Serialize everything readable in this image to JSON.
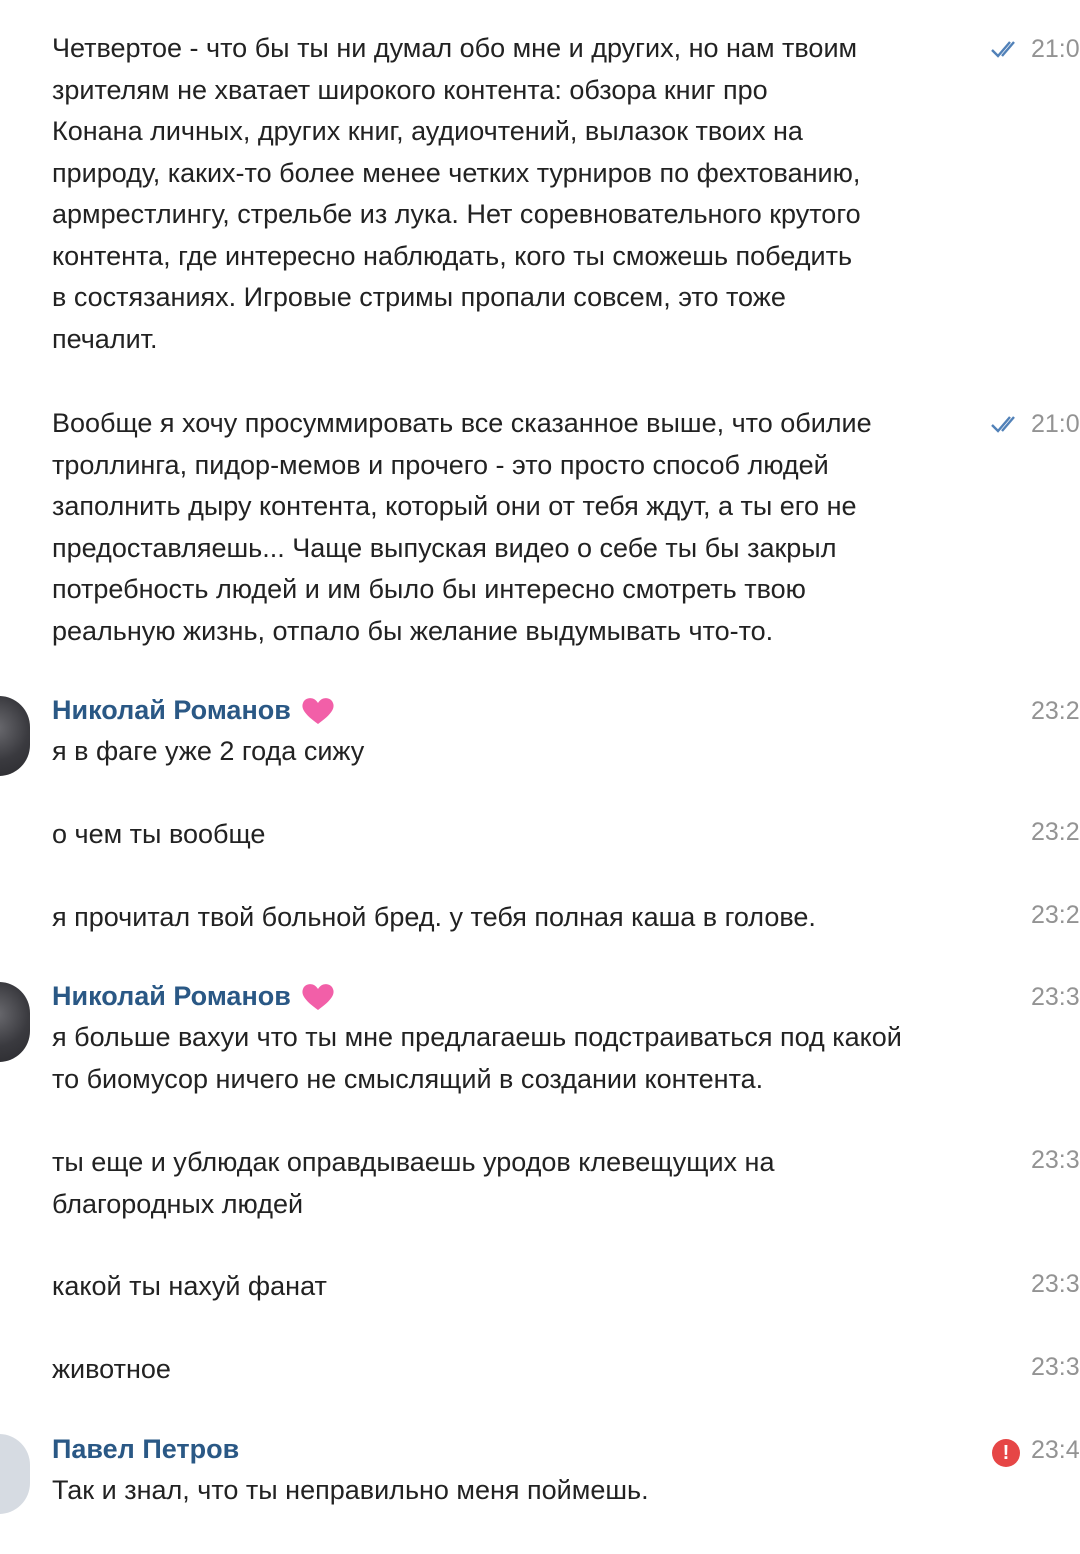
{
  "messages": [
    {
      "text": "Четвертое - что бы ты ни думал обо мне и других, но нам твоим\nзрителям не хватает широкого контента: обзора книг про\nКонана личных, других книг, аудиочтений, вылазок твоих на\nприроду, каких-то более менее четких турниров по фехтованию,\nармрестлингу, стрельбе из лука. Нет соревновательного крутого\nконтента, где интересно наблюдать, кого ты сможешь победить\nв состязаниях. Игровые стримы пропали совсем, это тоже\nпечалит.",
      "time": "21:0"
    },
    {
      "text": "Вообще я хочу просуммировать все сказанное выше, что обилие\nтроллинга, пидор-мемов и прочего - это просто способ людей\nзаполнить дыру контента, который они от тебя ждут, а ты его не\nпредоставляешь... Чаще выпуская видео о себе ты бы закрыл\nпотребность людей и им было бы интересно смотреть твою\nреальную жизнь, отпало бы желание выдумывать что-то.",
      "time": "21:0"
    }
  ],
  "group1": {
    "author": "Николай Романов",
    "messages": [
      {
        "text": "я в фаге уже 2 года сижу",
        "time": "23:2"
      },
      {
        "text": "о чем ты вообще",
        "time": "23:2"
      },
      {
        "text": "я прочитал твой больной бред. у тебя полная каша в голове.",
        "time": "23:2"
      }
    ]
  },
  "group2": {
    "author": "Николай Романов",
    "messages": [
      {
        "text": "я больше вахуи что ты мне предлагаешь подстраиваться под какой\nто биомусор ничего не смыслящий в создании контента.",
        "time": "23:3"
      },
      {
        "text": "ты еще и ублюдак оправдываешь уродов клевещущих на\nблагородных людей",
        "time": "23:3"
      },
      {
        "text": "какой ты нахуй фанат",
        "time": "23:3"
      },
      {
        "text": "животное",
        "time": "23:3"
      }
    ]
  },
  "group3": {
    "author": "Павел Петров",
    "messages": [
      {
        "text": "Так и знал, что ты неправильно меня поймешь.",
        "time": "23:4",
        "error_icon": "!"
      }
    ]
  },
  "colors": {
    "author": "#2a5885",
    "time": "#939393",
    "checks": "#5181b8",
    "heart": "#f25fa8",
    "error": "#e64646"
  },
  "icons": [
    "read-checks-icon",
    "heart-icon",
    "error-icon",
    "avatar"
  ]
}
